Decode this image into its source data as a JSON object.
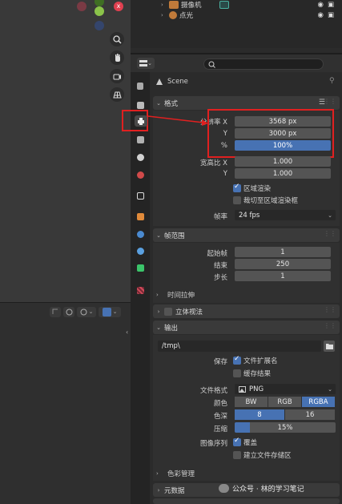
{
  "outliner": {
    "rows": [
      {
        "label": "摄像机"
      },
      {
        "label": "点光"
      }
    ]
  },
  "properties": {
    "search_placeholder": "",
    "context_label": "Scene",
    "format": {
      "title": "格式",
      "res_x_label": "分辨率 X",
      "res_x_value": "3568 px",
      "res_y_label": "Y",
      "res_y_value": "3000 px",
      "res_pct_label": "%",
      "res_pct_value": "100%",
      "aspect_x_label": "宽高比 X",
      "aspect_x_value": "1.000",
      "aspect_y_label": "Y",
      "aspect_y_value": "1.000",
      "border_label": "区域渲染",
      "crop_label": "裁切至区域渲染框",
      "fps_label": "帧率",
      "fps_value": "24 fps"
    },
    "frame_range": {
      "title": "帧范围",
      "start_label": "起始帧",
      "start_value": "1",
      "end_label": "结束",
      "end_value": "250",
      "step_label": "步长",
      "step_value": "1",
      "time_stretch": "时间拉伸"
    },
    "stereo": {
      "title": "立体视法"
    },
    "output": {
      "title": "输出",
      "path": "/tmp\\",
      "save_label": "保存",
      "file_ext_label": "文件扩展名",
      "cache_label": "缓存结果",
      "file_format_label": "文件格式",
      "file_format_value": "PNG",
      "color_label": "颜色",
      "color_options": [
        "BW",
        "RGB",
        "RGBA"
      ],
      "color_selected": "RGBA",
      "depth_label": "色深",
      "depth_options": [
        "8",
        "16"
      ],
      "depth_selected": "8",
      "compression_label": "压缩",
      "compression_value": "15%",
      "compression_fraction": 0.15,
      "sequence_label": "图像序列",
      "overwrite_label": "覆盖",
      "placeholders_label": "建立文件存储区",
      "color_mgmt": "色彩管理"
    },
    "metadata": {
      "title": "元数据"
    }
  },
  "watermark": "公众号 · 林的学习笔记",
  "colors": {
    "accent": "#4772b3",
    "highlight": "#e02020"
  }
}
